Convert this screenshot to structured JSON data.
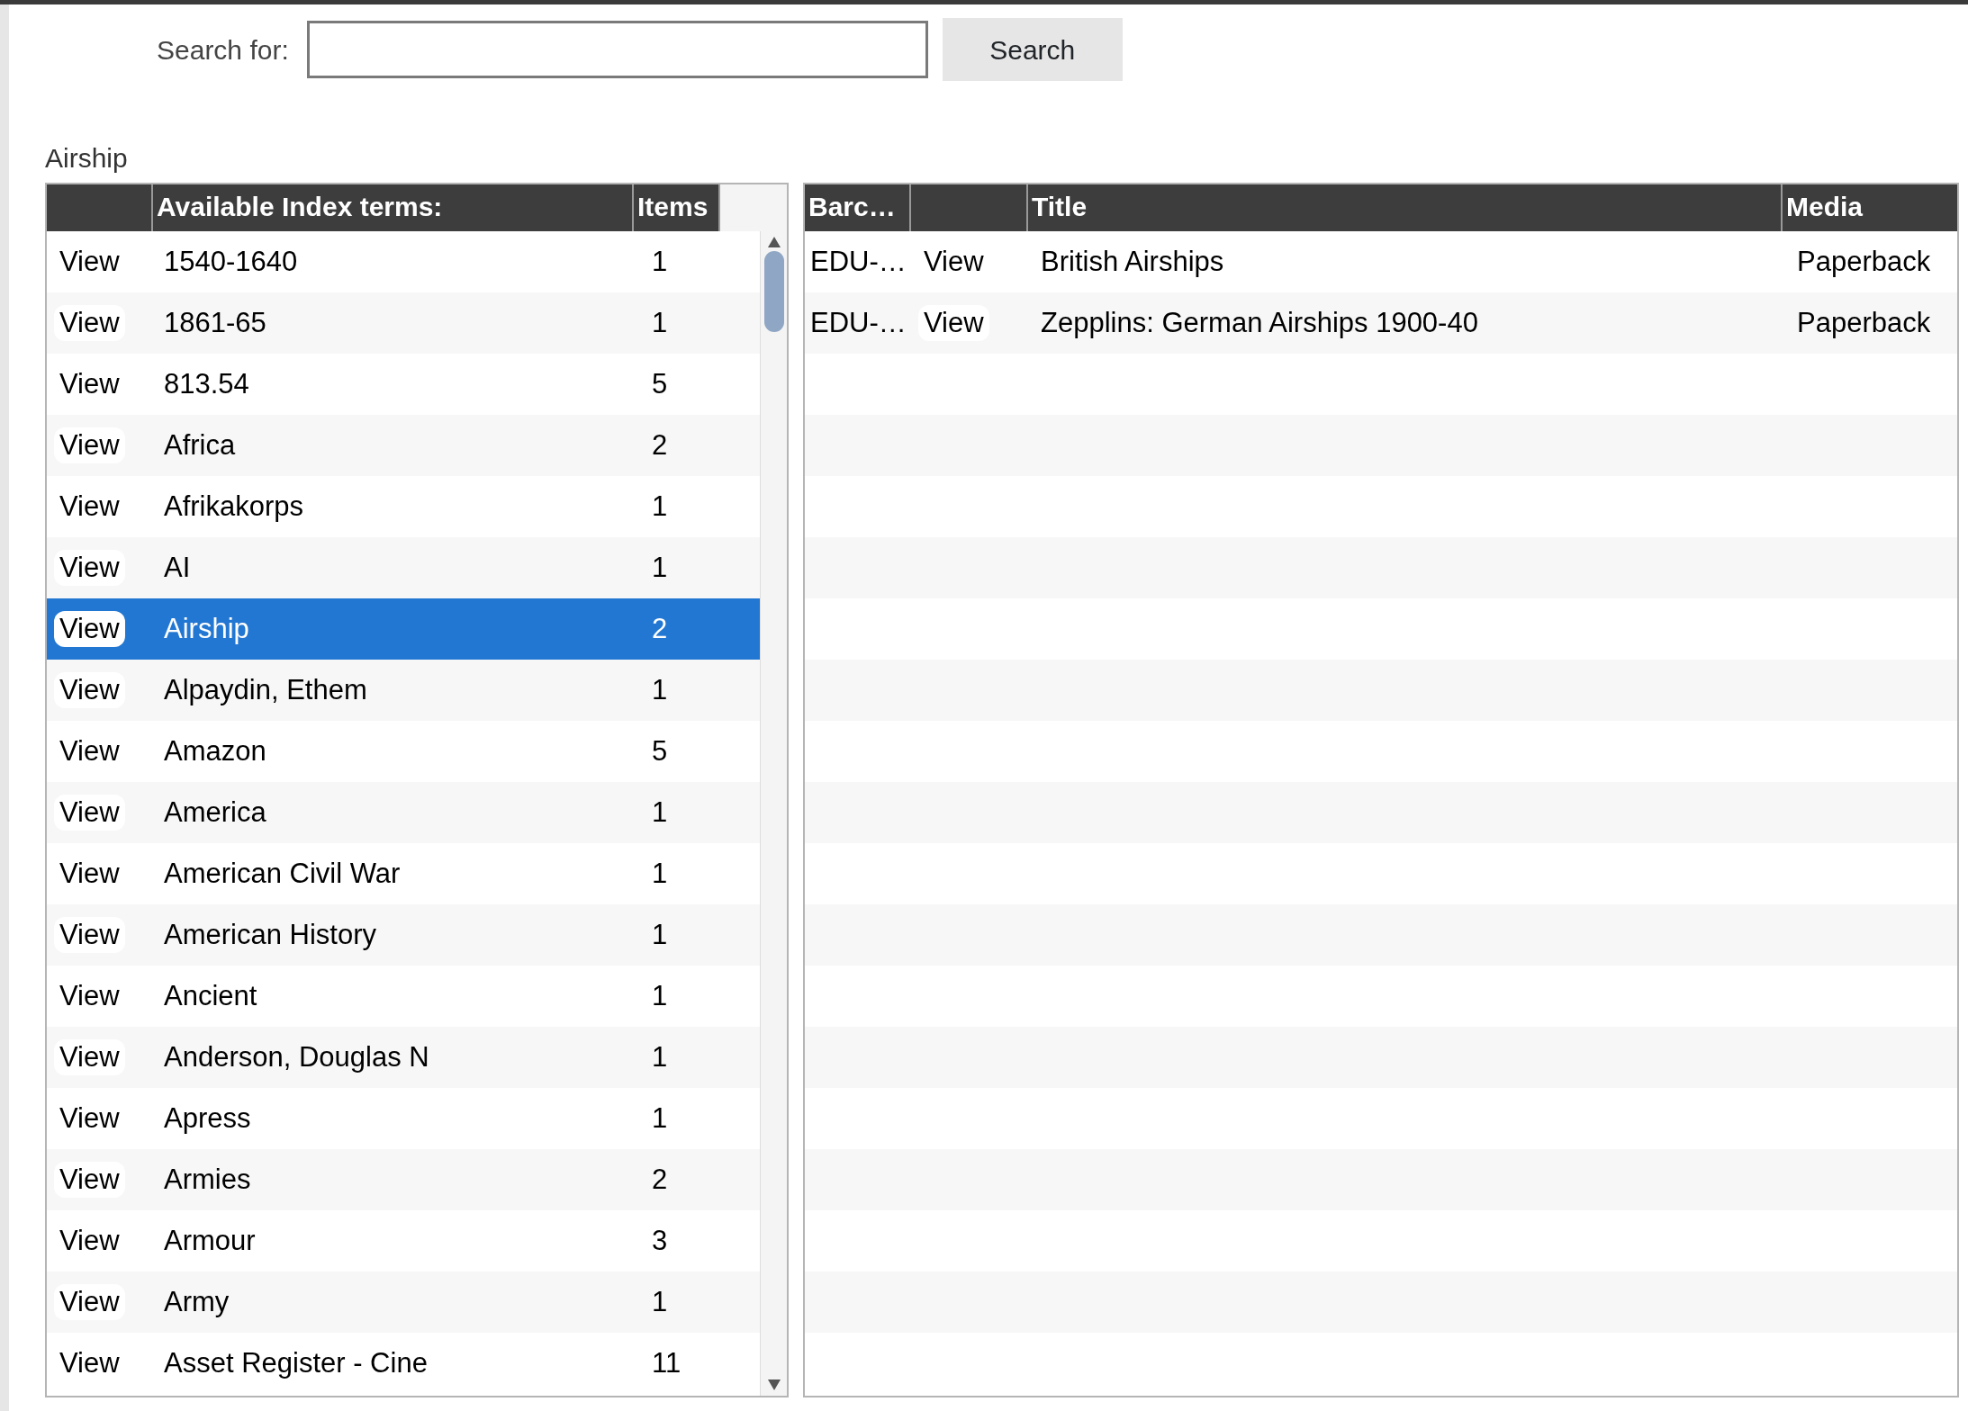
{
  "search": {
    "label": "Search for:",
    "button": "Search"
  },
  "heading": "Airship",
  "index_table": {
    "columns": [
      "Available Index terms:",
      "Items"
    ],
    "rows": [
      {
        "action": "View",
        "term": "1540-1640",
        "items": "1",
        "selected": false
      },
      {
        "action": "View",
        "term": "1861-65",
        "items": "1",
        "selected": false
      },
      {
        "action": "View",
        "term": "813.54",
        "items": "5",
        "selected": false
      },
      {
        "action": "View",
        "term": "Africa",
        "items": "2",
        "selected": false
      },
      {
        "action": "View",
        "term": "Afrikakorps",
        "items": "1",
        "selected": false
      },
      {
        "action": "View",
        "term": "AI",
        "items": "1",
        "selected": false
      },
      {
        "action": "View",
        "term": "Airship",
        "items": "2",
        "selected": true
      },
      {
        "action": "View",
        "term": "Alpaydin, Ethem",
        "items": "1",
        "selected": false
      },
      {
        "action": "View",
        "term": "Amazon",
        "items": "5",
        "selected": false
      },
      {
        "action": "View",
        "term": "America",
        "items": "1",
        "selected": false
      },
      {
        "action": "View",
        "term": "American Civil War",
        "items": "1",
        "selected": false
      },
      {
        "action": "View",
        "term": "American History",
        "items": "1",
        "selected": false
      },
      {
        "action": "View",
        "term": "Ancient",
        "items": "1",
        "selected": false
      },
      {
        "action": "View",
        "term": "Anderson, Douglas N",
        "items": "1",
        "selected": false
      },
      {
        "action": "View",
        "term": "Apress",
        "items": "1",
        "selected": false
      },
      {
        "action": "View",
        "term": "Armies",
        "items": "2",
        "selected": false
      },
      {
        "action": "View",
        "term": "Armour",
        "items": "3",
        "selected": false
      },
      {
        "action": "View",
        "term": "Army",
        "items": "1",
        "selected": false
      },
      {
        "action": "View",
        "term": "Asset Register - Cine",
        "items": "11",
        "selected": false
      }
    ]
  },
  "items_table": {
    "columns": [
      "Barc…",
      "Title",
      "Media"
    ],
    "rows": [
      {
        "barcode": "EDU-…",
        "action": "View",
        "title": "British Airships",
        "media": "Paperback"
      },
      {
        "barcode": "EDU-…",
        "action": "View",
        "title": "Zepplins: German Airships 1900-40",
        "media": "Paperback"
      }
    ]
  }
}
